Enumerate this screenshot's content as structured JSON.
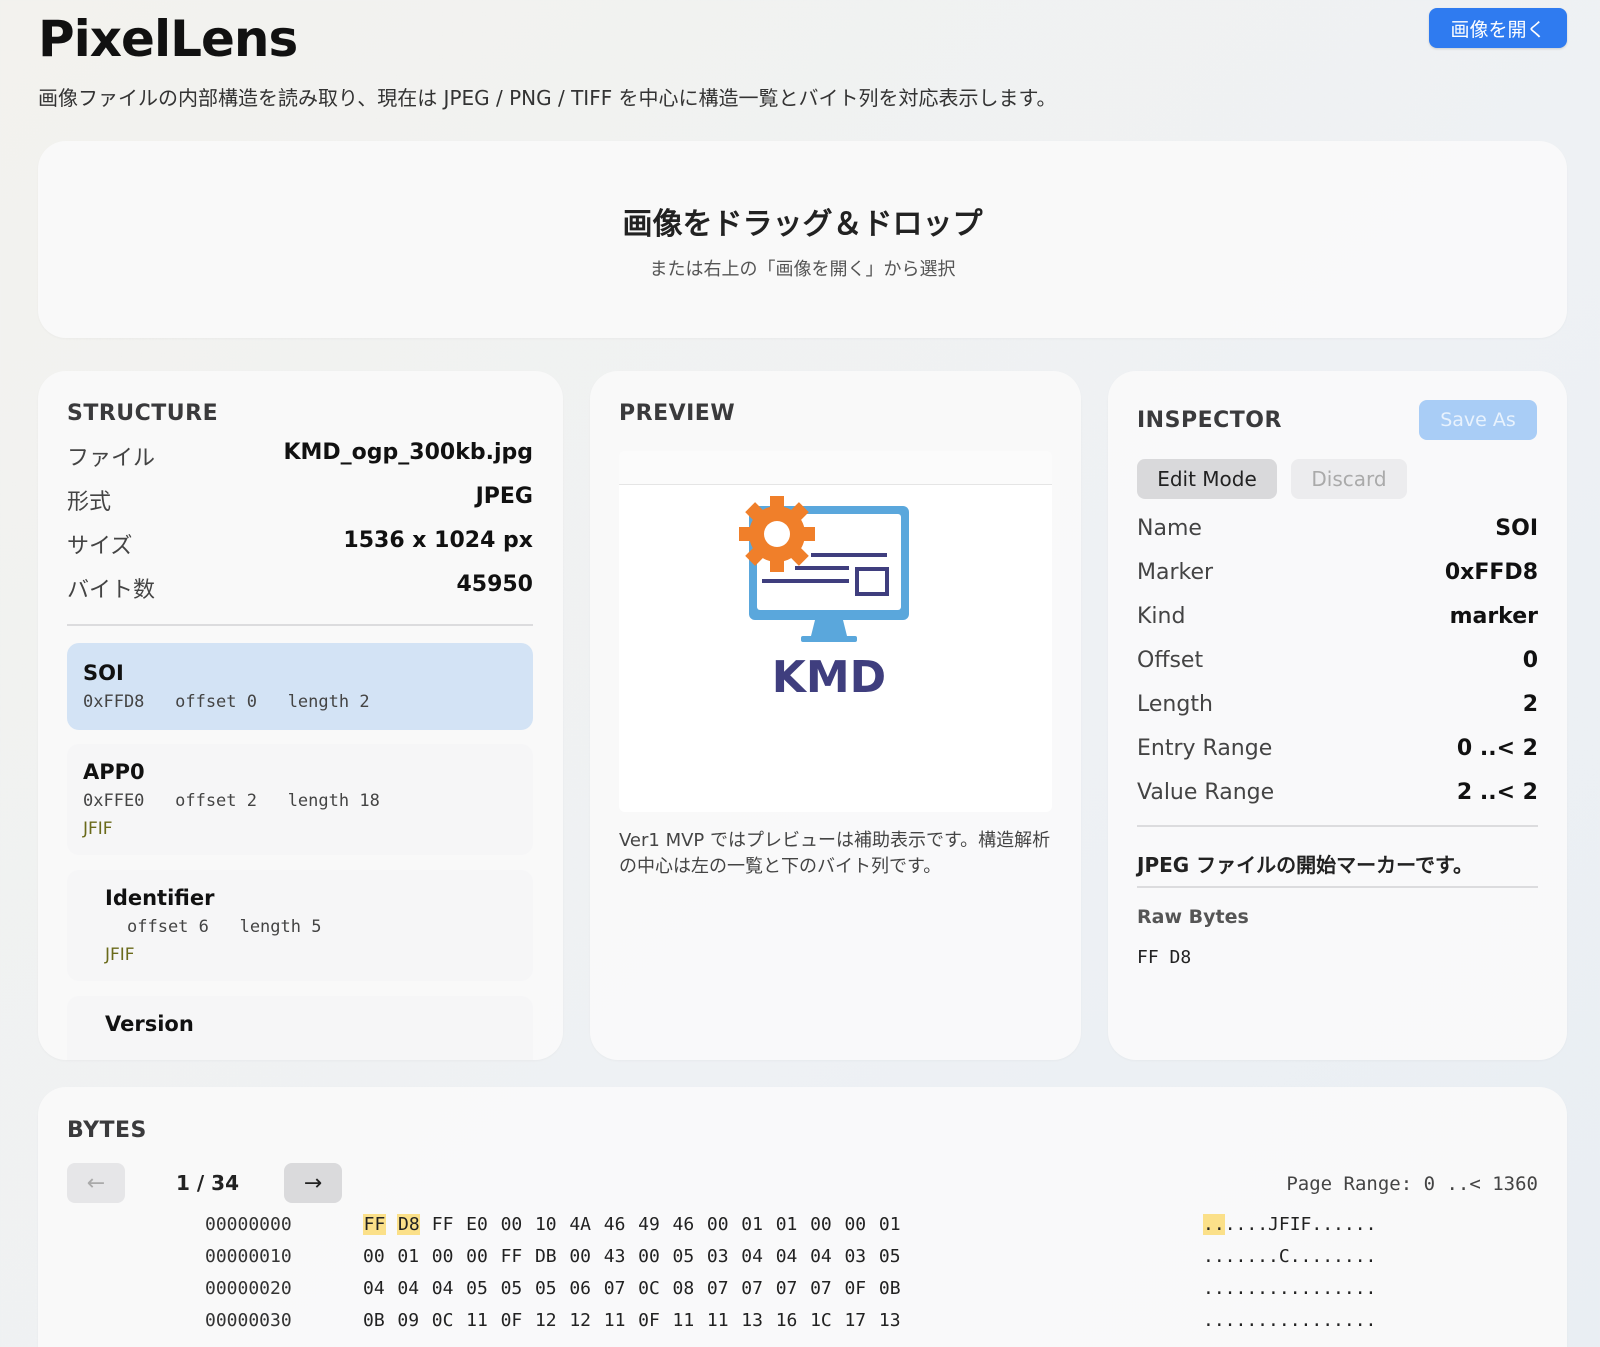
{
  "app": {
    "title": "PixelLens",
    "subtitle": "画像ファイルの内部構造を読み取り、現在は JPEG / PNG / TIFF を中心に構造一覧とバイト列を対応表示します。",
    "open_button": "画像を開く"
  },
  "dropzone": {
    "title": "画像をドラッグ＆ドロップ",
    "hint": "または右上の「画像を開く」から選択"
  },
  "structure": {
    "title": "STRUCTURE",
    "file_info": [
      {
        "key": "ファイル",
        "value": "KMD_ogp_300kb.jpg"
      },
      {
        "key": "形式",
        "value": "JPEG"
      },
      {
        "key": "サイズ",
        "value": "1536 x 1024 px"
      },
      {
        "key": "バイト数",
        "value": "45950"
      }
    ],
    "segments": [
      {
        "name": "SOI",
        "meta": "0xFFD8   offset 0   length 2",
        "note": ""
      },
      {
        "name": "APP0",
        "meta": "0xFFE0   offset 2   length 18",
        "note": "JFIF"
      },
      {
        "name": "Identifier",
        "meta": "offset 6   length 5",
        "note": "JFIF"
      },
      {
        "name": "Version",
        "meta": "",
        "note": ""
      }
    ]
  },
  "preview": {
    "title": "PREVIEW",
    "logo_text": "KMD",
    "note": "Ver1 MVP ではプレビューは補助表示です。構造解析の中心は左の一覧と下のバイト列です。"
  },
  "inspector": {
    "title": "INSPECTOR",
    "save_as": "Save As",
    "edit_mode": "Edit Mode",
    "discard": "Discard",
    "fields": [
      {
        "key": "Name",
        "value": "SOI"
      },
      {
        "key": "Marker",
        "value": "0xFFD8"
      },
      {
        "key": "Kind",
        "value": "marker"
      },
      {
        "key": "Offset",
        "value": "0"
      },
      {
        "key": "Length",
        "value": "2"
      },
      {
        "key": "Entry Range",
        "value": "0 ..< 2"
      },
      {
        "key": "Value Range",
        "value": "2 ..< 2"
      }
    ],
    "description": "JPEG ファイルの開始マーカーです。",
    "raw_bytes_title": "Raw Bytes",
    "raw_bytes": "FF D8"
  },
  "bytes": {
    "title": "BYTES",
    "prev_icon": "←",
    "next_icon": "→",
    "page_indicator": "1 / 34",
    "page_range": "Page Range: 0 ..< 1360",
    "rows": [
      {
        "offset": "00000000",
        "hex": [
          "FF",
          "D8",
          "FF",
          "E0",
          "00",
          "10",
          "4A",
          "46",
          "49",
          "46",
          "00",
          "01",
          "01",
          "00",
          "00",
          "01"
        ],
        "ascii_hl": "..",
        "ascii": "....JFIF......"
      },
      {
        "offset": "00000010",
        "hex": [
          "00",
          "01",
          "00",
          "00",
          "FF",
          "DB",
          "00",
          "43",
          "00",
          "05",
          "03",
          "04",
          "04",
          "04",
          "03",
          "05"
        ],
        "ascii_hl": "",
        "ascii": ".......C........"
      },
      {
        "offset": "00000020",
        "hex": [
          "04",
          "04",
          "04",
          "05",
          "05",
          "05",
          "06",
          "07",
          "0C",
          "08",
          "07",
          "07",
          "07",
          "07",
          "0F",
          "0B"
        ],
        "ascii_hl": "",
        "ascii": "................"
      },
      {
        "offset": "00000030",
        "hex": [
          "0B",
          "09",
          "0C",
          "11",
          "0F",
          "12",
          "12",
          "11",
          "0F",
          "11",
          "11",
          "13",
          "16",
          "1C",
          "17",
          "13"
        ],
        "ascii_hl": "",
        "ascii": "................"
      }
    ],
    "highlight_count": 2
  },
  "colors": {
    "accent": "#2f7bf0",
    "selected_row": "#d3e3f5",
    "byte_highlight": "#fbe089",
    "logo_orange": "#f07f2a",
    "logo_blue": "#4e9ad3",
    "logo_navy": "#3f3e7e"
  }
}
